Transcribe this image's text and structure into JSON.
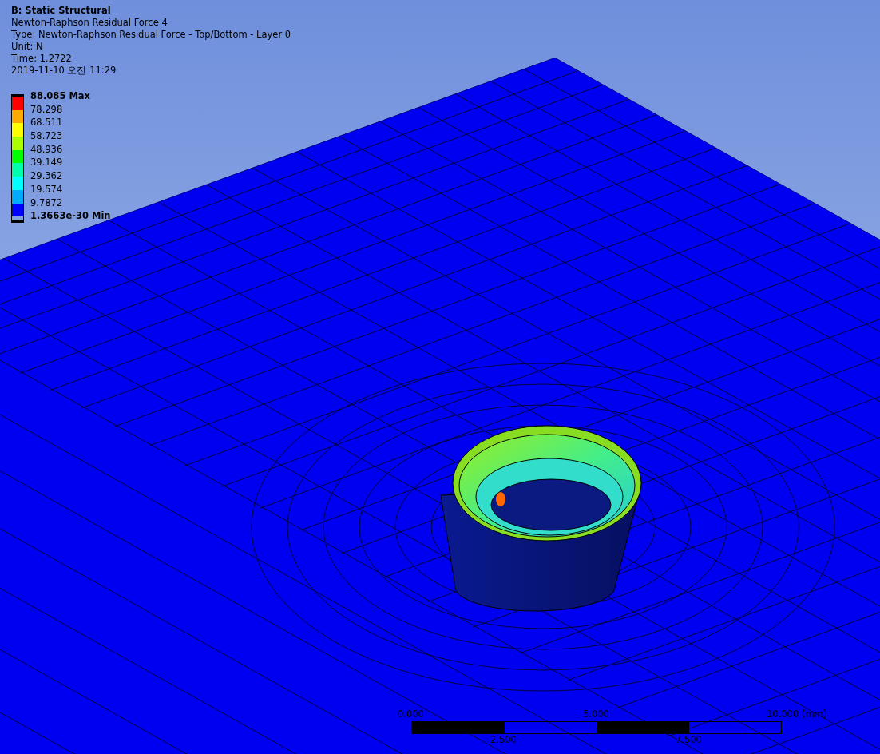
{
  "header": {
    "title": "B: Static Structural",
    "lines": [
      "Newton-Raphson Residual Force 4",
      "Type: Newton-Raphson Residual Force - Top/Bottom - Layer 0",
      "Unit: N",
      "Time: 1.2722",
      "2019-11-10 오전 11:29"
    ]
  },
  "legend": {
    "labels": [
      {
        "text": "88.085 Max",
        "kind": "max"
      },
      {
        "text": "78.298",
        "kind": "value"
      },
      {
        "text": "68.511",
        "kind": "value"
      },
      {
        "text": "58.723",
        "kind": "value"
      },
      {
        "text": "48.936",
        "kind": "value"
      },
      {
        "text": "39.149",
        "kind": "value"
      },
      {
        "text": "29.362",
        "kind": "value"
      },
      {
        "text": "19.574",
        "kind": "value"
      },
      {
        "text": "9.7872",
        "kind": "value"
      },
      {
        "text": "1.3663e-30 Min",
        "kind": "min"
      }
    ],
    "bands": [
      {
        "color": "#ff0000"
      },
      {
        "color": "#ffaa00"
      },
      {
        "color": "#ffff00"
      },
      {
        "color": "#aaff00"
      },
      {
        "color": "#00ff00"
      },
      {
        "color": "#00ffaa"
      },
      {
        "color": "#00ffff"
      },
      {
        "color": "#00aaff"
      },
      {
        "color": "#0000ff"
      }
    ]
  },
  "scale": {
    "top_labels": [
      "0.000",
      "5.000",
      "10.000 (mm)"
    ],
    "bottom_labels": [
      "2.500",
      "7.500"
    ]
  }
}
